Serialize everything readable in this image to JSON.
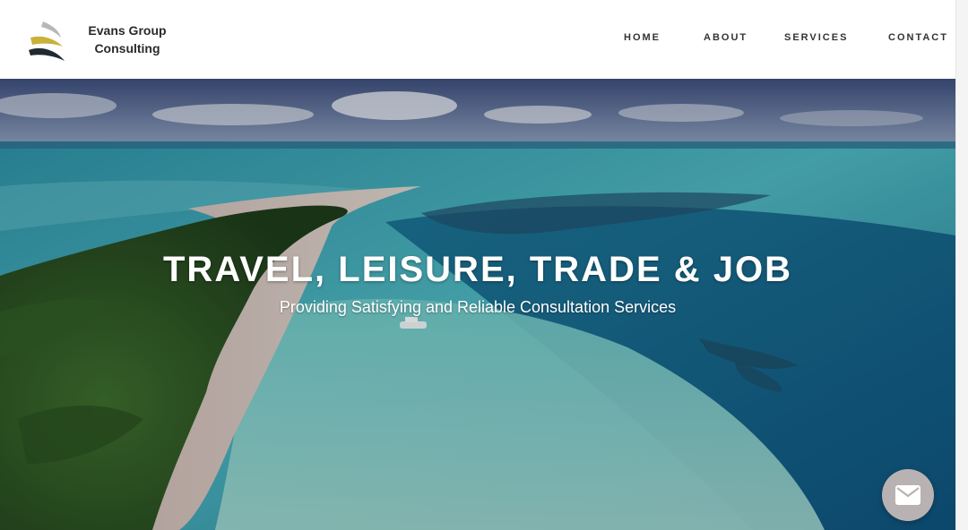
{
  "brand": {
    "name_line1": "Evans Group",
    "name_line2": "Consulting",
    "logo_icon": "brand-swoosh-logo",
    "colors": {
      "gold": "#c9b13a",
      "dark": "#1f2a33",
      "grey": "#b8b8b8"
    }
  },
  "nav": {
    "home": "HOME",
    "about": "ABOUT",
    "services": "SERVICES",
    "contact": "CONTACT"
  },
  "hero": {
    "title": "TRAVEL, LEISURE, TRADE & JOB",
    "subtitle": "Providing Satisfying and Reliable Consultation Services",
    "background": "tropical-island-aerial-photo"
  },
  "fab": {
    "icon": "envelope-icon",
    "color": "#b9b2b2"
  }
}
